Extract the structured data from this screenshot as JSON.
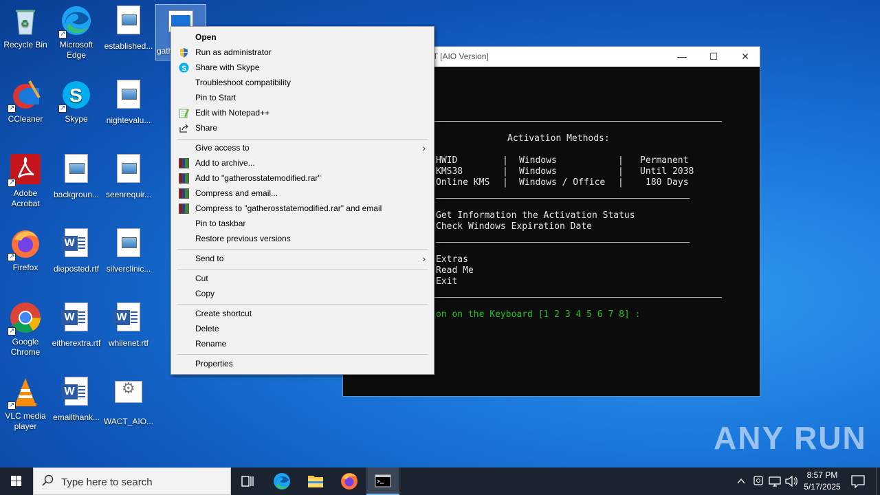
{
  "desktop": {
    "icons": [
      {
        "label": "Recycle Bin",
        "icon": "recycle-bin-icon"
      },
      {
        "label": "Microsoft Edge",
        "icon": "edge-icon"
      },
      {
        "label": "established...",
        "icon": "image-file-icon"
      },
      {
        "label": "gath mod",
        "icon": "image-file-icon"
      },
      {
        "label": "CCleaner",
        "icon": "ccleaner-icon"
      },
      {
        "label": "Skype",
        "icon": "skype-icon"
      },
      {
        "label": "nightevalu...",
        "icon": "image-file-icon"
      },
      {
        "label": "Adobe Acrobat",
        "icon": "acrobat-icon"
      },
      {
        "label": "backgroun...",
        "icon": "image-file-icon"
      },
      {
        "label": "seenrequir...",
        "icon": "image-file-icon"
      },
      {
        "label": "Firefox",
        "icon": "firefox-icon"
      },
      {
        "label": "dieposted.rtf",
        "icon": "word-doc-icon"
      },
      {
        "label": "silverclinic...",
        "icon": "image-file-icon"
      },
      {
        "label": "Google Chrome",
        "icon": "chrome-icon"
      },
      {
        "label": "eitherextra.rtf",
        "icon": "word-doc-icon"
      },
      {
        "label": "whilenet.rtf",
        "icon": "word-doc-icon"
      },
      {
        "label": "VLC media player",
        "icon": "vlc-icon"
      },
      {
        "label": "emailthank...",
        "icon": "word-doc-icon"
      },
      {
        "label": "WACT_AIO...",
        "icon": "gear-file-icon"
      }
    ]
  },
  "console": {
    "title": "CT [AIO Version]",
    "minimize": "—",
    "maximize": "☐",
    "close": "✕",
    "header": "Activation Methods:",
    "methods": [
      {
        "name": "HWID",
        "os": "Windows",
        "type": "Permanent"
      },
      {
        "name": "KMS38",
        "os": "Windows",
        "type": "Until 2038"
      },
      {
        "name": "Online KMS",
        "os": "Windows / Office",
        "type": "180 Days"
      }
    ],
    "info": [
      "Get Information the Activation Status",
      "Check Windows Expiration Date"
    ],
    "extras": [
      "Extras",
      "Read Me",
      "Exit"
    ],
    "prompt": "on on the Keyboard [1 2 3 4 5 6 7 8] :"
  },
  "context_menu": {
    "items": [
      {
        "label": "Open",
        "icon": "",
        "bold": true
      },
      {
        "label": "Run as administrator",
        "icon": "uac-shield-icon"
      },
      {
        "label": "Share with Skype",
        "icon": "skype-icon"
      },
      {
        "label": "Troubleshoot compatibility",
        "icon": ""
      },
      {
        "label": "Pin to Start",
        "icon": ""
      },
      {
        "label": "Edit with Notepad++",
        "icon": "notepadpp-icon"
      },
      {
        "label": "Share",
        "icon": "share-icon"
      },
      {
        "label": "Give access to",
        "icon": "",
        "submenu": true
      },
      {
        "label": "Add to archive...",
        "icon": "winrar-icon"
      },
      {
        "label": "Add to \"gatherosstatemodified.rar\"",
        "icon": "winrar-icon"
      },
      {
        "label": "Compress and email...",
        "icon": "winrar-icon"
      },
      {
        "label": "Compress to \"gatherosstatemodified.rar\" and email",
        "icon": "winrar-icon"
      },
      {
        "label": "Pin to taskbar",
        "icon": ""
      },
      {
        "label": "Restore previous versions",
        "icon": ""
      },
      {
        "label": "Send to",
        "icon": "",
        "submenu": true
      },
      {
        "label": "Cut",
        "icon": ""
      },
      {
        "label": "Copy",
        "icon": ""
      },
      {
        "label": "Create shortcut",
        "icon": ""
      },
      {
        "label": "Delete",
        "icon": ""
      },
      {
        "label": "Rename",
        "icon": ""
      },
      {
        "label": "Properties",
        "icon": ""
      }
    ]
  },
  "taskbar": {
    "search_placeholder": "Type here to search",
    "time": "8:57 PM",
    "date": "5/17/2025"
  },
  "watermark": "ANY RUN"
}
